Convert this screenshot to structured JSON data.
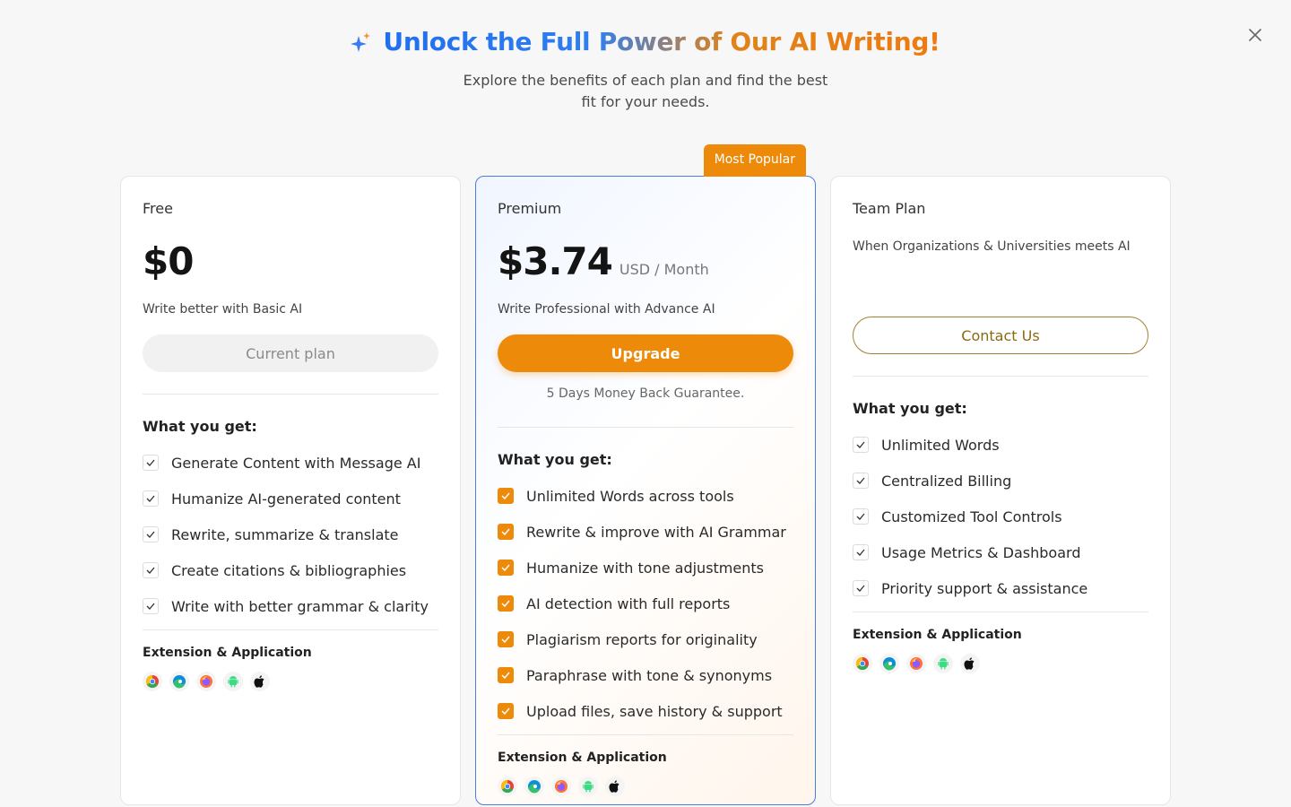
{
  "header": {
    "title": "Unlock the Full Power of Our AI Writing!",
    "subtitle": "Explore the benefits of each plan and find the best fit for your needs."
  },
  "plans": {
    "free": {
      "name": "Free",
      "price": "$0",
      "description": "Write better with Basic AI",
      "button_label": "Current plan",
      "features_title": "What you get:",
      "features": [
        "Generate Content with Message AI",
        "Humanize AI-generated content",
        "Rewrite, summarize & translate",
        "Create citations & bibliographies",
        "Write with better grammar & clarity"
      ],
      "extensions_title": "Extension & Application"
    },
    "premium": {
      "badge": "Most Popular",
      "name": "Premium",
      "price": "$3.74",
      "price_unit": "USD / Month",
      "description": "Write Professional with Advance AI",
      "button_label": "Upgrade",
      "guarantee": "5 Days Money Back Guarantee.",
      "features_title": "What you get:",
      "features": [
        "Unlimited Words across tools",
        "Rewrite & improve with AI Grammar",
        "Humanize with tone adjustments",
        "AI detection with full reports",
        "Plagiarism reports for originality",
        "Paraphrase with tone & synonyms",
        "Upload files, save history & support"
      ],
      "extensions_title": "Extension & Application"
    },
    "team": {
      "name": "Team Plan",
      "description": "When Organizations & Universities meets AI",
      "button_label": "Contact Us",
      "features_title": "What you get:",
      "features": [
        "Unlimited Words",
        "Centralized Billing",
        "Customized Tool Controls",
        "Usage Metrics & Dashboard",
        "Priority support & assistance"
      ],
      "extensions_title": "Extension & Application"
    }
  },
  "extension_icons": [
    "chrome-icon",
    "edge-icon",
    "firefox-icon",
    "android-icon",
    "apple-icon"
  ],
  "colors": {
    "accent_orange": "#ee8a0a",
    "accent_blue": "#1f6ff0",
    "premium_border": "#4a7fd9",
    "contact_text": "#8a6a10"
  }
}
